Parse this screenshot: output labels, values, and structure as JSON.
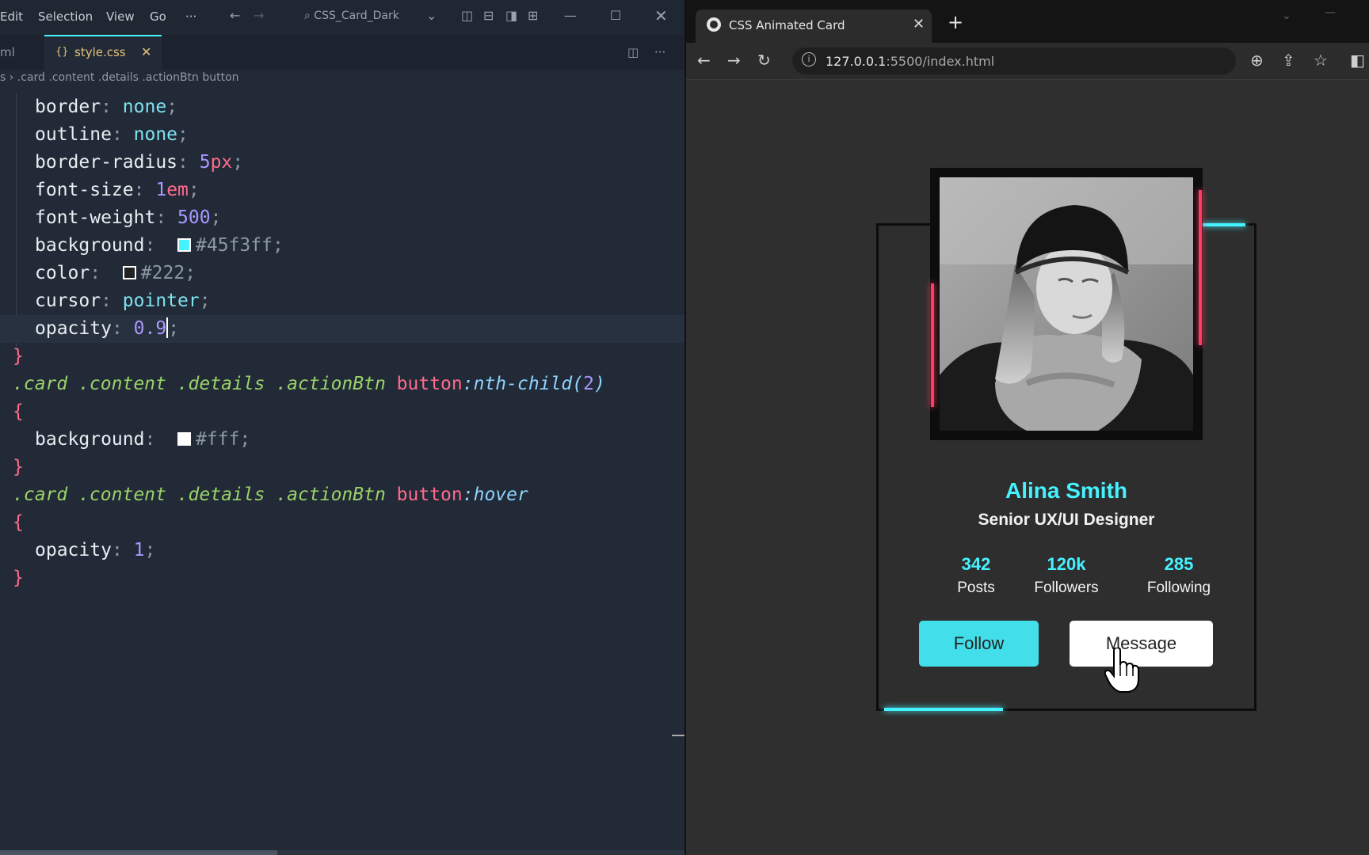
{
  "editor": {
    "menu": {
      "edit": "Edit",
      "selection": "Selection",
      "view": "View",
      "go": "Go",
      "more": "···"
    },
    "command_center": "CSS_Card_Dark",
    "tabs": {
      "prev_tab": "ml",
      "active_tab": "style.css",
      "active_tab_icon": "{}"
    },
    "breadcrumb": "s  ›  .card .content .details .actionBtn button",
    "code": {
      "l1_prop": "border",
      "l1_val": "none",
      "l2_prop": "outline",
      "l2_val": "none",
      "l3_prop": "border-radius",
      "l3_num": "5",
      "l3_unit": "px",
      "l4_prop": "font-size",
      "l4_num": "1",
      "l4_unit": "em",
      "l5_prop": "font-weight",
      "l5_val": "500",
      "l6_prop": "background",
      "l6_val": "#45f3ff",
      "l7_prop": "color",
      "l7_val": "#222",
      "l8_prop": "cursor",
      "l8_val": "pointer",
      "l9_prop": "opacity",
      "l9_val": "0.9",
      "sel_a": ".card .content .details .actionBtn",
      "sel_a_tag": "button",
      "sel_a_pseudo": ":nth-child(",
      "sel_a_arg": "2",
      "l13_prop": "background",
      "l13_val": "#fff",
      "sel_b": ".card .content .details .actionBtn",
      "sel_b_tag": "button",
      "sel_b_pseudo": ":hover",
      "l17_prop": "opacity",
      "l17_val": "1"
    },
    "colors": {
      "swatch_cyan": "#45f3ff",
      "swatch_dark": "#222222",
      "swatch_white": "#ffffff"
    }
  },
  "browser": {
    "tab_title": "CSS Animated Card",
    "url_host": "127.0.0.1",
    "url_rest": ":5500/index.html"
  },
  "card": {
    "name": "Alina Smith",
    "role": "Senior UX/UI Designer",
    "stats": [
      {
        "value": "342",
        "label": "Posts"
      },
      {
        "value": "120k",
        "label": "Followers"
      },
      {
        "value": "285",
        "label": "Following"
      }
    ],
    "follow_label": "Follow",
    "message_label": "Message",
    "colors": {
      "accent": "#45f3ff",
      "glow_pink": "#ff3c64",
      "bg": "#2e2e2e"
    }
  }
}
